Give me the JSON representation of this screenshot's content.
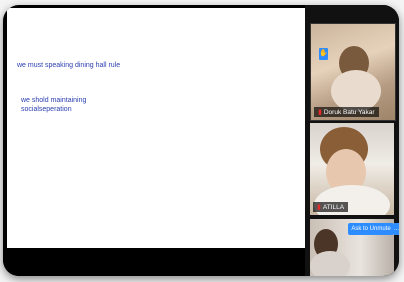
{
  "share_screen": {
    "line1": "we must speaking dining hall rule",
    "line2": "we shold maintaining\nsocialseperation"
  },
  "participants": [
    {
      "name": "Doruk Batu Yakar",
      "muted": true
    },
    {
      "name": "ATILLA",
      "muted": true
    },
    {
      "name": "",
      "muted": false
    }
  ],
  "controls": {
    "unmute_label": "Ask to Unmute",
    "more_label": "..."
  },
  "colors": {
    "text_blue": "#2a3fb0",
    "zoom_blue": "#2d8cff",
    "mic_red": "#e22b2b"
  },
  "icons": {
    "mic_muted": "mic-muted-icon",
    "hand": "hand-icon"
  }
}
